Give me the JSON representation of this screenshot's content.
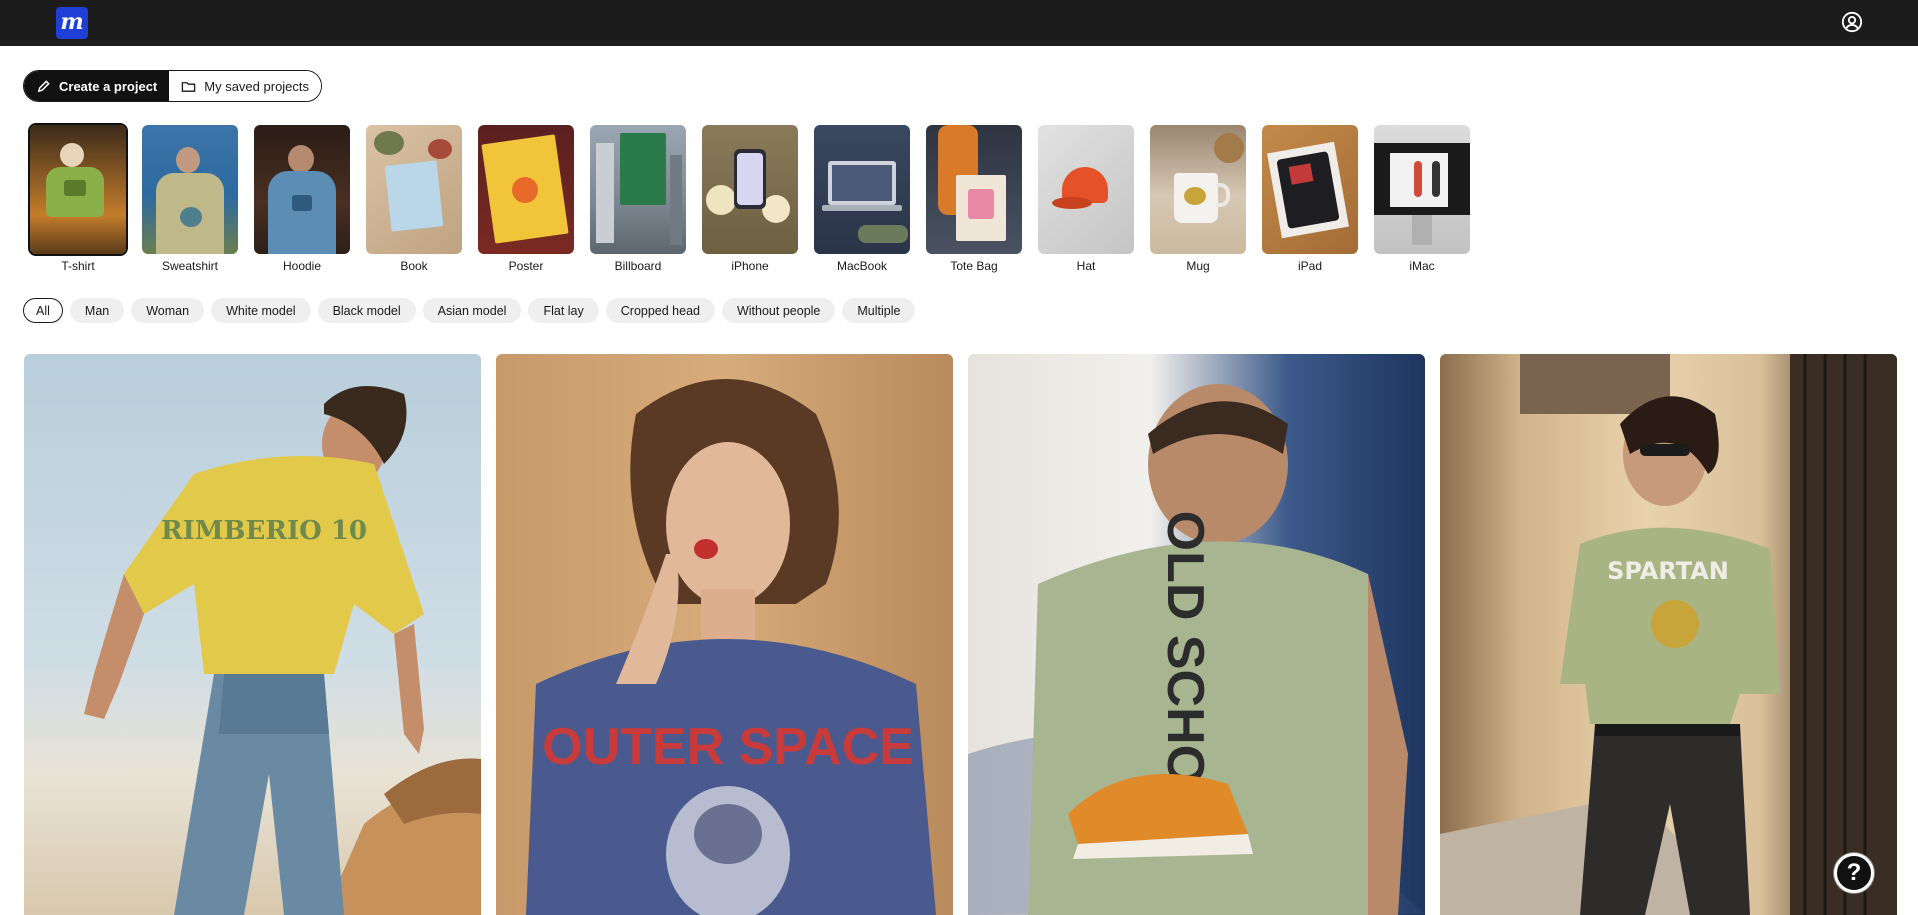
{
  "header": {
    "logo_letter": "m",
    "account_icon": "user-circle-icon"
  },
  "project_toggle": {
    "create_label": "Create a project",
    "saved_label": "My saved projects"
  },
  "categories": [
    {
      "label": "T-shirt",
      "selected": true
    },
    {
      "label": "Sweatshirt"
    },
    {
      "label": "Hoodie"
    },
    {
      "label": "Book"
    },
    {
      "label": "Poster"
    },
    {
      "label": "Billboard"
    },
    {
      "label": "iPhone"
    },
    {
      "label": "MacBook"
    },
    {
      "label": "Tote Bag"
    },
    {
      "label": "Hat"
    },
    {
      "label": "Mug"
    },
    {
      "label": "iPad"
    },
    {
      "label": "iMac"
    }
  ],
  "filters": [
    {
      "label": "All",
      "active": true
    },
    {
      "label": "Man"
    },
    {
      "label": "Woman"
    },
    {
      "label": "White model"
    },
    {
      "label": "Black model"
    },
    {
      "label": "Asian model"
    },
    {
      "label": "Flat lay"
    },
    {
      "label": "Cropped head"
    },
    {
      "label": "Without people"
    },
    {
      "label": "Multiple"
    }
  ],
  "gallery": [
    {
      "print_text": "RIMBERIO 10"
    },
    {
      "print_text": "OUTER SPACE"
    },
    {
      "print_text": "OLD SCHOOL"
    },
    {
      "print_text": "SPARTAN"
    }
  ],
  "help_label": "?",
  "colors": {
    "topbar": "#1c1c1c",
    "logo_bg": "#1f3fd6",
    "chip_bg": "#efefef"
  }
}
